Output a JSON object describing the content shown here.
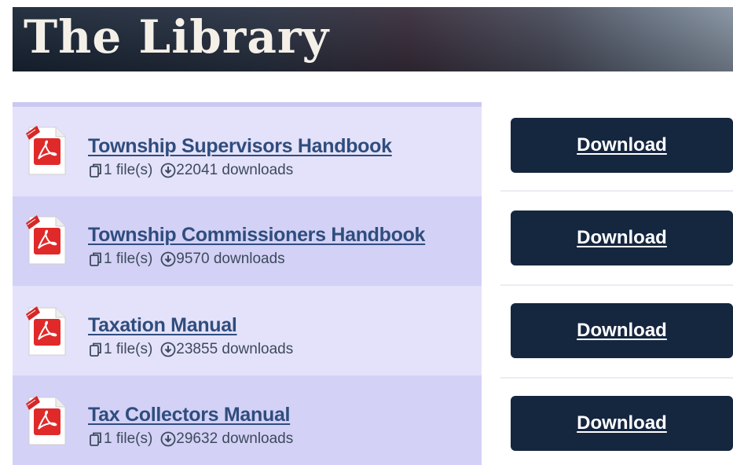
{
  "header": {
    "title": "The Library"
  },
  "items": [
    {
      "title": "Township Supervisors Handbook",
      "files": "1 file(s)",
      "downloads": "22041 downloads",
      "button_label": "Download",
      "icon": "pdf-icon"
    },
    {
      "title": "Township Commissioners Handbook",
      "files": "1 file(s)",
      "downloads": "9570 downloads",
      "button_label": "Download",
      "icon": "pdf-icon"
    },
    {
      "title": "Taxation Manual",
      "files": "1 file(s)",
      "downloads": "23855 downloads",
      "button_label": "Download",
      "icon": "pdf-icon"
    },
    {
      "title": "Tax Collectors Manual",
      "files": "1 file(s)",
      "downloads": "29632 downloads",
      "button_label": "Download",
      "icon": "pdf-icon"
    }
  ],
  "colors": {
    "button_bg": "#15263f",
    "title_link": "#2f4d7d",
    "list_bg": "#dedcf8",
    "list_bg_alt": "#d3d1f6"
  }
}
